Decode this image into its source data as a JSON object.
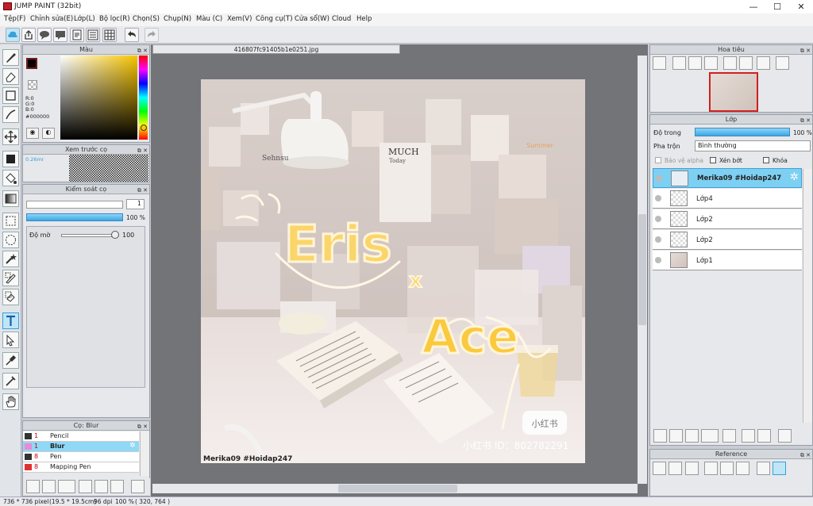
{
  "window": {
    "title": "JUMP PAINT (32bit)"
  },
  "menu": [
    "Tệp(F)",
    "Chỉnh sửa(E)",
    "Lớp(L)",
    "Bộ lọc(R)",
    "Chọn(S)",
    "Chụp(N)",
    "Màu (C)",
    "Xem(V)",
    "Công cụ(T)",
    "Cửa sổ(W)",
    "Cloud",
    "Help"
  ],
  "doc": {
    "filename": "416807fc91405b1e0251.jpg"
  },
  "color_panel": {
    "title": "Màu",
    "r": "R:0",
    "g": "G:0",
    "b": "B:0",
    "hex": "#000000",
    "fg": "#000000",
    "bg": "#ffffff"
  },
  "brush_preview": {
    "title": "Xem trước cọ",
    "size": "0.26mr"
  },
  "brush_control": {
    "title": "Kiểm soát cọ",
    "size_value": "1",
    "percent": "100 %",
    "opacity_label": "Độ mờ",
    "opacity_value": "100"
  },
  "brush_list": {
    "title": "Cọ: Blur",
    "items": [
      {
        "size": "1",
        "name": "Pencil",
        "color": "#333333"
      },
      {
        "size": "1",
        "name": "Blur",
        "color": "#e88ad8"
      },
      {
        "size": "8",
        "name": "Pen",
        "color": "#333333"
      },
      {
        "size": "8",
        "name": "Mapping Pen",
        "color": "#e03030"
      }
    ]
  },
  "navigator": {
    "title": "Hoa tiêu"
  },
  "layer_panel": {
    "title": "Lớp",
    "opacity_label": "Độ trong",
    "opacity_value": "100 %",
    "blend_label": "Pha trộn",
    "blend_value": "Bình thường",
    "protect_alpha": "Bảo vệ alpha",
    "clipping": "Xén bớt",
    "lock": "Khóa",
    "layers": [
      "Merika09 #Hoidap247",
      "Lớp4",
      "Lớp2",
      "Lớp2",
      "Lớp1"
    ]
  },
  "reference": {
    "title": "Reference"
  },
  "canvas": {
    "watermark": "Merika09 #Hoidap247",
    "rednote_id": "小红书 ID：802782291",
    "rednote_logo": "小红书",
    "word1": "Eris",
    "word2": "Ace",
    "cross": "x",
    "poster_title": "MUCH",
    "poster_sub": "Today",
    "box_label": "Sehnsu",
    "summer": "Summer"
  },
  "status": {
    "pixels": "736 * 736 pixel",
    "cm": "(19.5 * 19.5cm)",
    "dpi": "96 dpi",
    "zoom": "100 %",
    "coords": "( 320, 764 )"
  }
}
